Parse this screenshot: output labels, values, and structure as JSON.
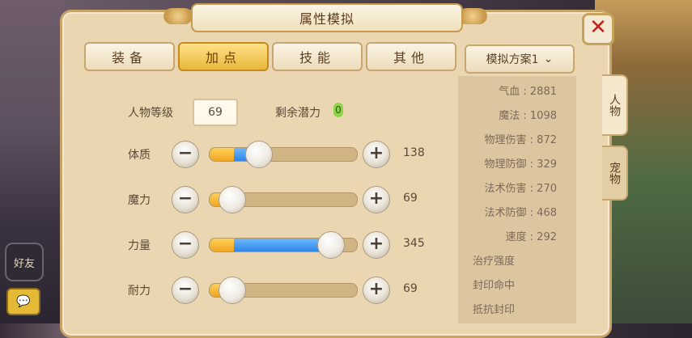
{
  "window": {
    "title": "属性模拟"
  },
  "sidebar_bg": {
    "friend_label": "好友",
    "chat_icon": "chat-icon"
  },
  "tabs": [
    {
      "label": "装备",
      "active": false
    },
    {
      "label": "加点",
      "active": true
    },
    {
      "label": "技能",
      "active": false
    },
    {
      "label": "其他",
      "active": false
    }
  ],
  "scheme": {
    "label": "模拟方案1"
  },
  "character": {
    "level_label": "人物等级",
    "level_value": "69",
    "remaining_label": "剩余潜力",
    "remaining_value": "0"
  },
  "attributes": [
    {
      "name": "体质",
      "value": "138",
      "blue_fraction": 0.1,
      "knob_fraction": 0.33
    },
    {
      "name": "魔力",
      "value": "69",
      "blue_fraction": 0.0,
      "knob_fraction": 0.15
    },
    {
      "name": "力量",
      "value": "345",
      "blue_fraction": 0.6,
      "knob_fraction": 0.82
    },
    {
      "name": "耐力",
      "value": "69",
      "blue_fraction": 0.0,
      "knob_fraction": 0.15
    }
  ],
  "stats": [
    {
      "label": "气血",
      "value": "2881"
    },
    {
      "label": "魔法",
      "value": "1098"
    },
    {
      "label": "物理伤害",
      "value": "872"
    },
    {
      "label": "物理防御",
      "value": "329"
    },
    {
      "label": "法术伤害",
      "value": "270"
    },
    {
      "label": "法术防御",
      "value": "468"
    },
    {
      "label": "速度",
      "value": "292"
    },
    {
      "label": "治疗强度",
      "value": ""
    },
    {
      "label": "封印命中",
      "value": ""
    },
    {
      "label": "抵抗封印",
      "value": ""
    }
  ],
  "side_tabs": [
    {
      "label": "人物",
      "active": true
    },
    {
      "label": "宠物",
      "active": false
    }
  ],
  "colors": {
    "accent": "#e9b83c",
    "close": "#c7201e",
    "slider_blue": "#2f86e6",
    "slider_orange": "#f0a521",
    "remaining_badge": "#8fd34a"
  }
}
